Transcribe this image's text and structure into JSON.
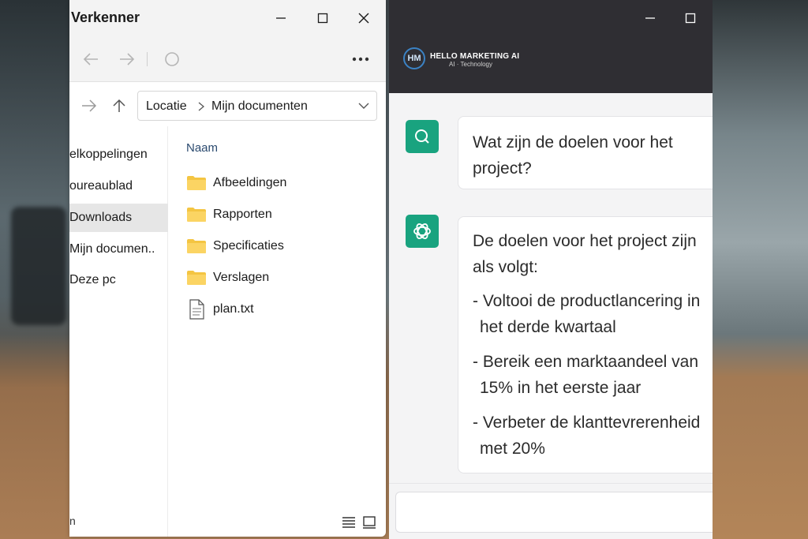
{
  "explorer": {
    "title": "Verkenner",
    "breadcrumb": [
      "Locatie",
      "Mijn documenten"
    ],
    "column_header": "Naam",
    "sidebar": [
      {
        "label": "elkoppelingen",
        "active": false
      },
      {
        "label": "oureaublad",
        "active": false
      },
      {
        "label": "Downloads",
        "active": true
      },
      {
        "label": "Mijn documen..",
        "active": false
      },
      {
        "label": "Deze pc",
        "active": false
      }
    ],
    "sidebar_bottom": "n",
    "files": [
      {
        "name": "Afbeeldingen",
        "type": "folder"
      },
      {
        "name": "Rapporten",
        "type": "folder"
      },
      {
        "name": "Specificaties",
        "type": "folder"
      },
      {
        "name": "Verslagen",
        "type": "folder"
      },
      {
        "name": "plan.txt",
        "type": "file"
      }
    ]
  },
  "chat": {
    "brand": {
      "logo": "HM",
      "name": "HELLO MARKETING AI",
      "tagline": "AI · Technology"
    },
    "question": "Wat zijn de doelen voor het project?",
    "answer_intro": "De doelen voor het project zijn als volgt:",
    "answer_bullets": [
      "- Voltooi de productlancering in het derde kwartaal",
      "- Bereik een marktaandeel van 15% in het eerste jaar",
      "- Verbeter de klanttevrerenheid met 20%"
    ],
    "accent_color": "#19a37f"
  }
}
